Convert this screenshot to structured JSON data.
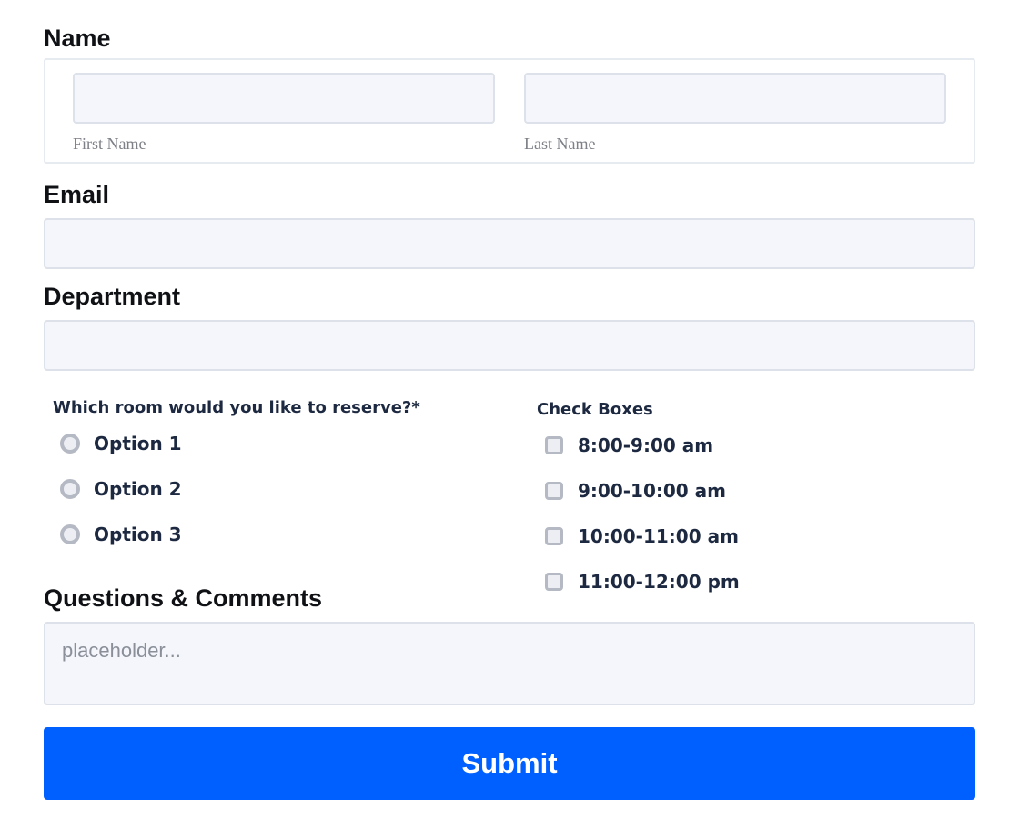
{
  "name_section": {
    "label": "Name",
    "first_name": {
      "value": "",
      "placeholder": "",
      "sublabel": "First Name"
    },
    "last_name": {
      "value": "",
      "placeholder": "",
      "sublabel": "Last Name"
    }
  },
  "email_section": {
    "label": "Email",
    "value": "",
    "placeholder": ""
  },
  "department_section": {
    "label": "Department",
    "value": "",
    "placeholder": ""
  },
  "room_section": {
    "label": "Which room would you like to reserve?*",
    "options": [
      {
        "label": "Option 1",
        "checked": false
      },
      {
        "label": "Option 2",
        "checked": false
      },
      {
        "label": "Option 3",
        "checked": false
      }
    ]
  },
  "checkbox_section": {
    "label": "Check Boxes",
    "options": [
      {
        "label": "8:00-9:00 am",
        "checked": false
      },
      {
        "label": "9:00-10:00 am",
        "checked": false
      },
      {
        "label": "10:00-11:00 am",
        "checked": false
      },
      {
        "label": "11:00-12:00 pm",
        "checked": false
      }
    ]
  },
  "comments_section": {
    "label": "Questions & Comments",
    "value": "",
    "placeholder": "placeholder..."
  },
  "submit": {
    "label": "Submit"
  },
  "colors": {
    "accent": "#0060ff",
    "field_bg": "#f4f6fc",
    "field_border": "#dde1e9",
    "choice_text": "#1d2940"
  },
  "icons": {
    "radio": "radio-circle-icon",
    "checkbox": "checkbox-square-icon"
  }
}
